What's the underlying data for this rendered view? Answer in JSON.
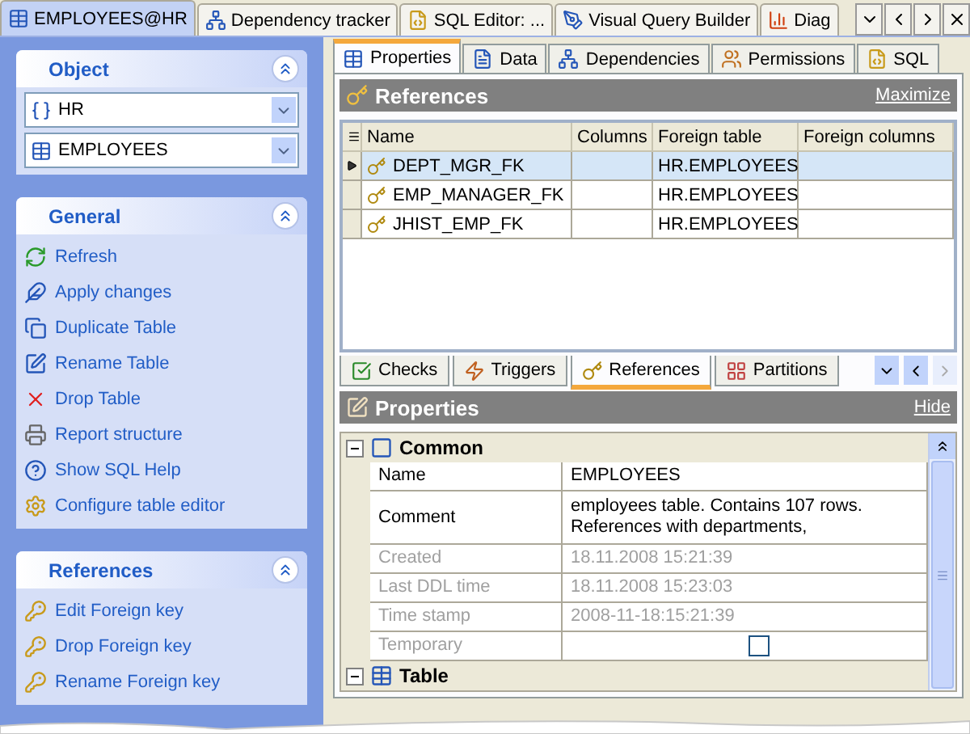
{
  "document_tabs": [
    {
      "label": "EMPLOYEES@HR",
      "selected": true
    },
    {
      "label": "Dependency tracker",
      "selected": false
    },
    {
      "label": "SQL Editor: ...",
      "selected": false
    },
    {
      "label": "Visual Query Builder",
      "selected": false
    },
    {
      "label": "Diag",
      "selected": false
    }
  ],
  "sidebar": {
    "object_panel": {
      "title": "Object",
      "expanded": true,
      "selectors": [
        {
          "value": "HR"
        },
        {
          "value": "EMPLOYEES"
        }
      ]
    },
    "general_panel": {
      "title": "General",
      "expanded": true,
      "items": [
        {
          "label": "Refresh"
        },
        {
          "label": "Apply changes"
        },
        {
          "label": "Duplicate Table"
        },
        {
          "label": "Rename Table"
        },
        {
          "label": "Drop Table"
        },
        {
          "label": "Report structure"
        },
        {
          "label": "Show SQL Help"
        },
        {
          "label": "Configure table editor"
        }
      ]
    },
    "references_panel": {
      "title": "References",
      "expanded": true,
      "items": [
        {
          "label": "Edit Foreign key"
        },
        {
          "label": "Drop Foreign key"
        },
        {
          "label": "Rename Foreign key"
        }
      ]
    }
  },
  "editor_tabs": [
    {
      "label": "Properties",
      "selected": true
    },
    {
      "label": "Data",
      "selected": false
    },
    {
      "label": "Dependencies",
      "selected": false
    },
    {
      "label": "Permissions",
      "selected": false
    },
    {
      "label": "SQL",
      "selected": false
    }
  ],
  "references_section": {
    "title": "References",
    "action": "Maximize",
    "table": {
      "columns": [
        "Name",
        "Columns",
        "Foreign table",
        "Foreign columns"
      ],
      "rows": [
        {
          "selected": true,
          "cells": [
            "DEPT_MGR_FK",
            "",
            "HR.EMPLOYEES",
            ""
          ]
        },
        {
          "selected": false,
          "cells": [
            "EMP_MANAGER_FK",
            "",
            "HR.EMPLOYEES",
            ""
          ]
        },
        {
          "selected": false,
          "cells": [
            "JHIST_EMP_FK",
            "",
            "HR.EMPLOYEES",
            ""
          ]
        }
      ]
    }
  },
  "sub_tabs": [
    {
      "label": "Checks",
      "selected": false
    },
    {
      "label": "Triggers",
      "selected": false
    },
    {
      "label": "References",
      "selected": true
    },
    {
      "label": "Partitions",
      "selected": false
    }
  ],
  "properties_section": {
    "title": "Properties",
    "action": "Hide",
    "groups": [
      {
        "title": "Common",
        "expanded": true,
        "rows": [
          {
            "kind": "text",
            "name": "Name",
            "value": "EMPLOYEES",
            "disabled": false
          },
          {
            "kind": "text",
            "name": "Comment",
            "value": "employees table. Contains 107 rows. References with departments,",
            "disabled": false
          },
          {
            "kind": "text",
            "name": "Created",
            "value": "18.11.2008 15:21:39",
            "disabled": true
          },
          {
            "kind": "text",
            "name": "Last DDL time",
            "value": "18.11.2008 15:23:03",
            "disabled": true
          },
          {
            "kind": "text",
            "name": "Time stamp",
            "value": "2008-11-18:15:21:39",
            "disabled": true
          },
          {
            "kind": "checkbox",
            "name": "Temporary",
            "checked": false,
            "disabled": true
          }
        ]
      },
      {
        "title": "Table",
        "expanded": true
      }
    ]
  }
}
